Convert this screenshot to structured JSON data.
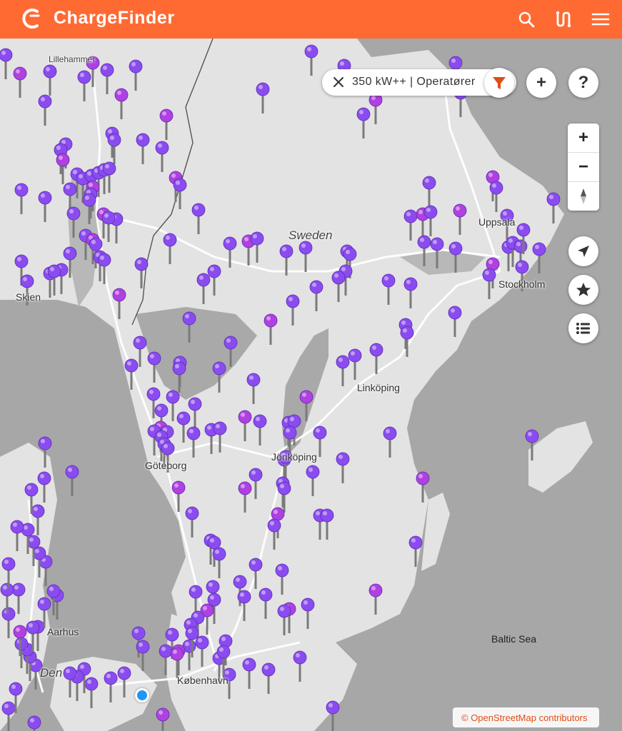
{
  "header": {
    "title": "ChargeFinder",
    "brand_color": "#ff6a33",
    "icons": [
      "search-icon",
      "route-icon",
      "menu-icon"
    ]
  },
  "filter": {
    "text": "350 kW++ | Operatører",
    "close_icon": "close-icon",
    "filter_icon": "filter-funnel-icon",
    "filter_icon_color": "#e04d14"
  },
  "buttons": {
    "add": "+",
    "help": "?",
    "zoom_in": "+",
    "zoom_out": "−"
  },
  "map": {
    "labels": {
      "sweden": "Sweden",
      "lillehammer": "Lillehammer",
      "skien": "Skien",
      "uppsala": "Uppsala",
      "stockholm": "Stockholm",
      "linkoping": "Linköping",
      "jonkoping": "Jönköping",
      "goteborg": "Göteborg",
      "aarhus": "Aarhus",
      "kobenhavn": "København",
      "denmark_partial": "Den",
      "baltic_sea": "Baltic Sea"
    },
    "pin_colors": {
      "default": "#8a4cf0",
      "highlight": "#b040e0"
    },
    "user_location_color": "#2196f3"
  },
  "attribution": "© OpenStreetMap contributors"
}
